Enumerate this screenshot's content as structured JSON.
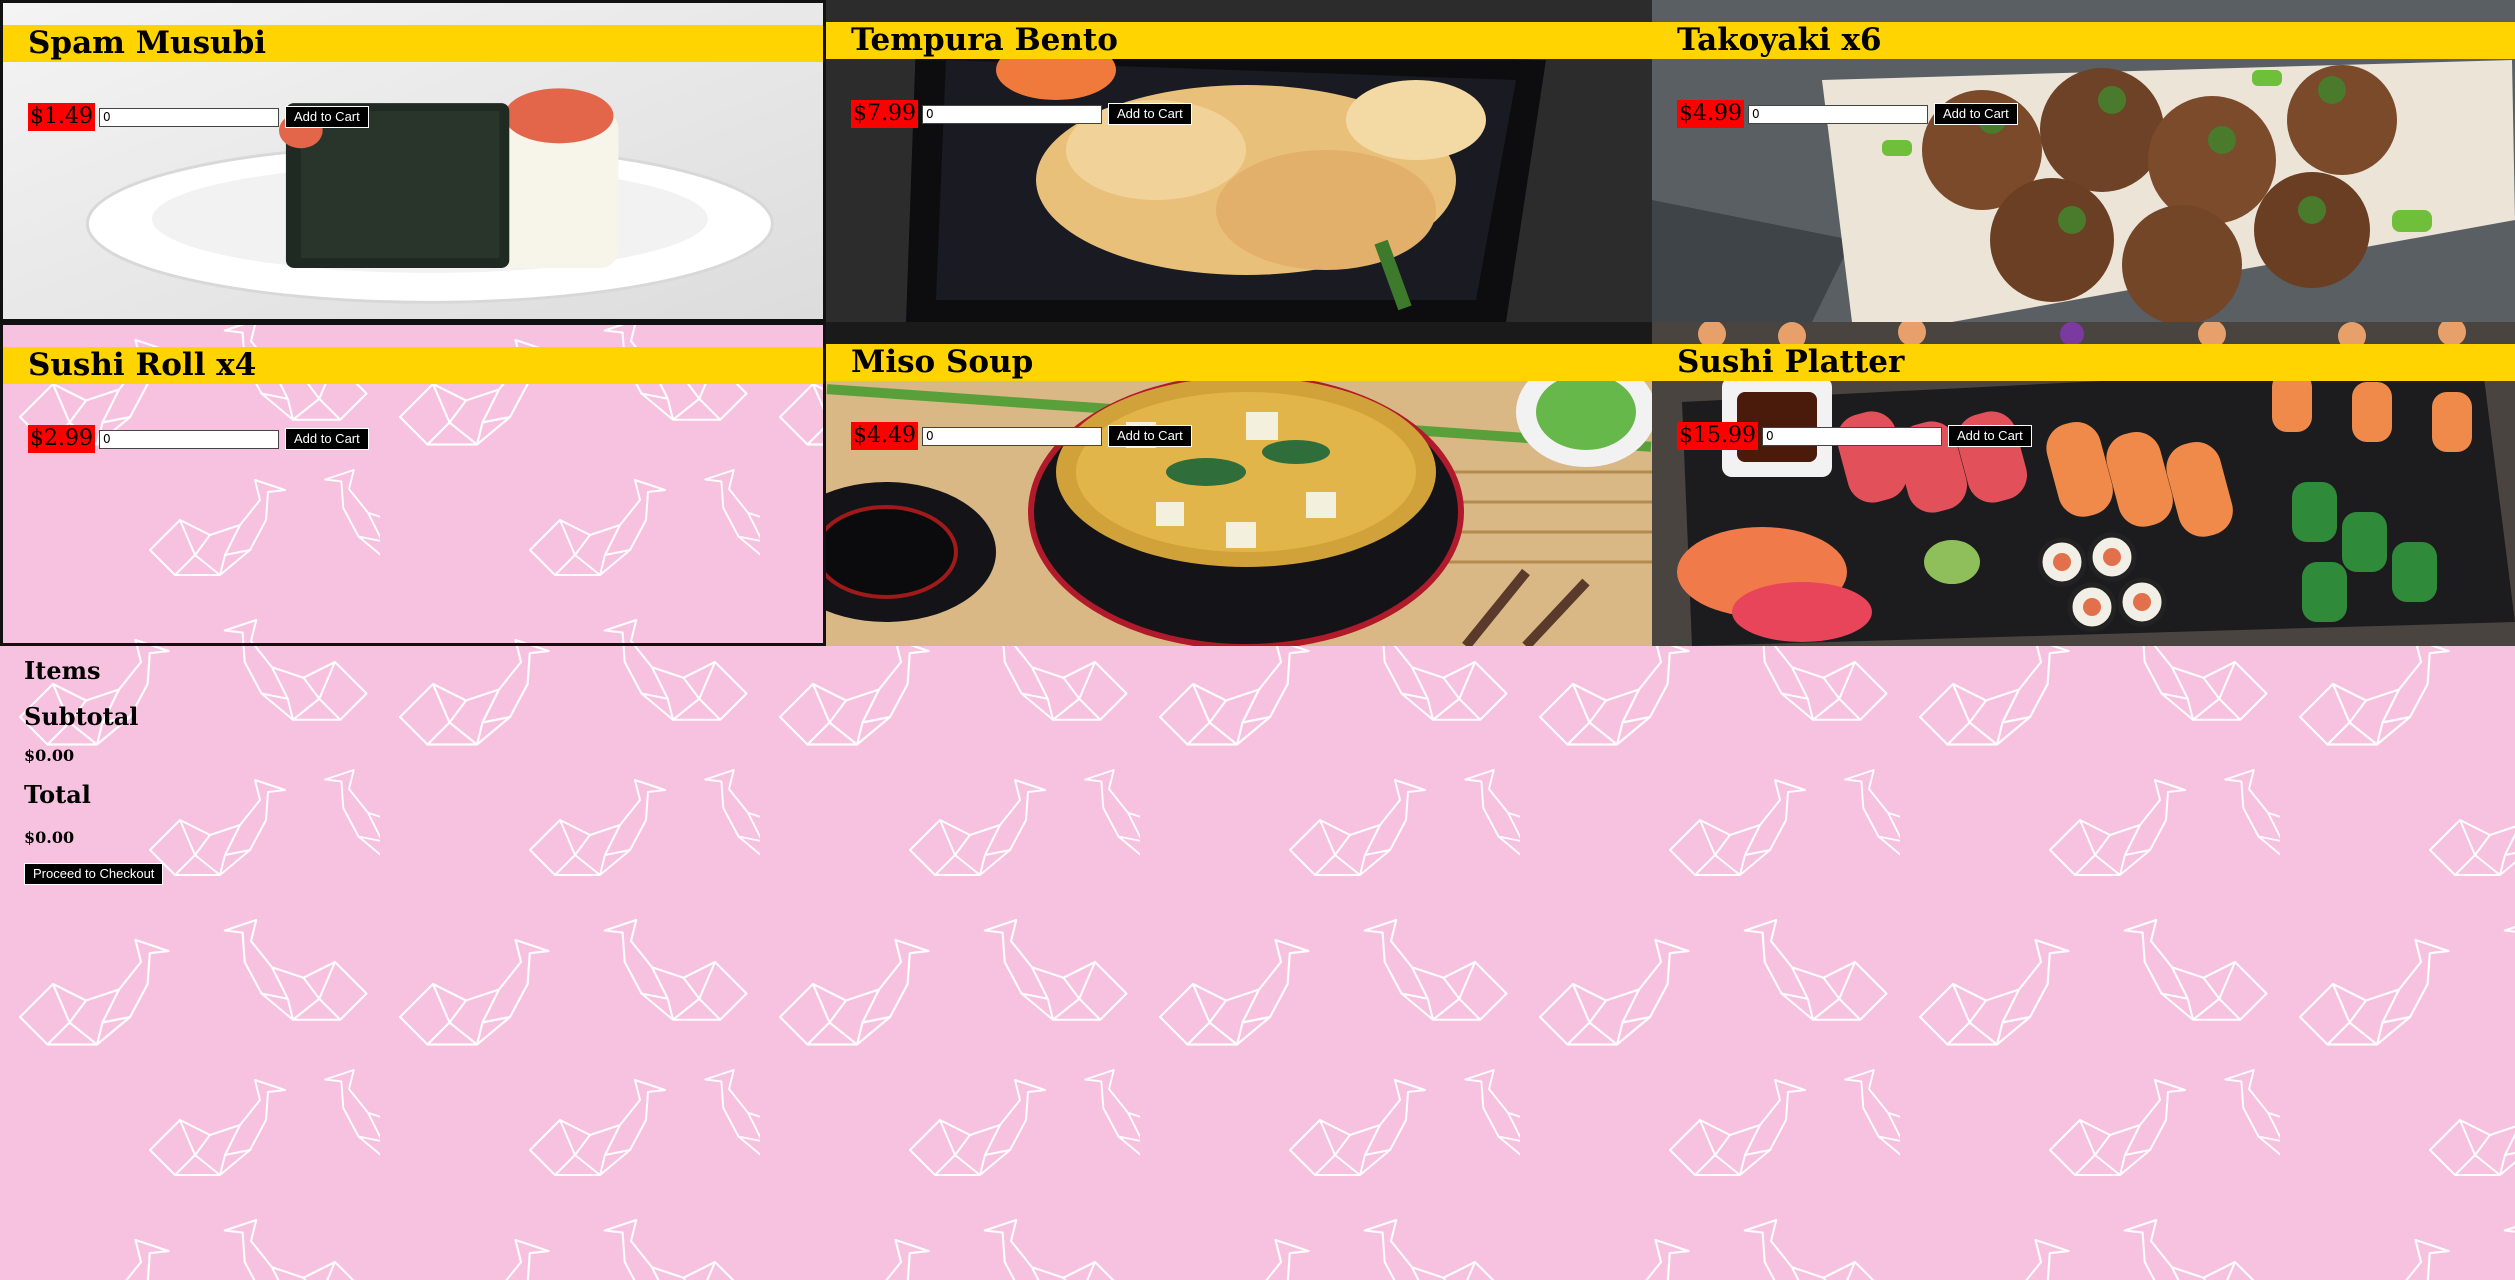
{
  "colors": {
    "background": "#f6c2e0",
    "title_bar": "#ffd400",
    "price_badge": "#ff0000",
    "button": "#000000"
  },
  "products": [
    {
      "name": "Spam Musubi",
      "price": "$1.49",
      "qty_value": "0",
      "button_label": "Add to Cart",
      "image": "spam-musubi-photo"
    },
    {
      "name": "Tempura Bento",
      "price": "$7.99",
      "qty_value": "0",
      "button_label": "Add to Cart",
      "image": "tempura-bento-photo"
    },
    {
      "name": "Takoyaki x6",
      "price": "$4.99",
      "qty_value": "0",
      "button_label": "Add to Cart",
      "image": "takoyaki-photo"
    },
    {
      "name": "Sushi Roll x4",
      "price": "$2.99",
      "qty_value": "0",
      "button_label": "Add to Cart",
      "image": "none-swan-pattern"
    },
    {
      "name": "Miso Soup",
      "price": "$4.49",
      "qty_value": "0",
      "button_label": "Add to Cart",
      "image": "miso-soup-photo"
    },
    {
      "name": "Sushi Platter",
      "price": "$15.99",
      "qty_value": "0",
      "button_label": "Add to Cart",
      "image": "sushi-platter-photo"
    }
  ],
  "cart": {
    "items_label": "Items",
    "subtotal_label": "Subtotal",
    "subtotal_value": "$0.00",
    "total_label": "Total",
    "total_value": "$0.00",
    "checkout_label": "Proceed to Checkout"
  }
}
